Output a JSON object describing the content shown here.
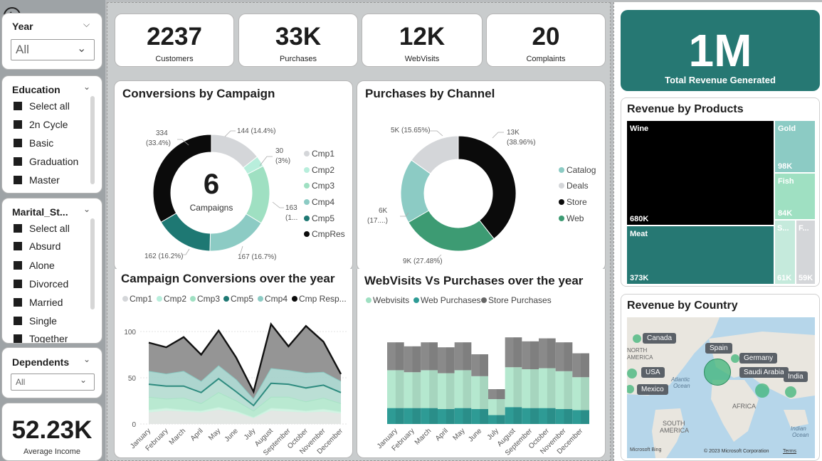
{
  "colors": {
    "teal_dark": "#1e7873",
    "teal": "#2e8b7f",
    "teal_light": "#8ccbc4",
    "mint": "#9fe0c2",
    "grey": "#d4d6d9",
    "black": "#0b0b0b",
    "green": "#3d9b73"
  },
  "back_icon": "back-arrow-icon",
  "slicers": {
    "year": {
      "title": "Year",
      "value": "All"
    },
    "education": {
      "title": "Education",
      "items": [
        "Select all",
        "2n Cycle",
        "Basic",
        "Graduation",
        "Master"
      ]
    },
    "marital": {
      "title": "Marital_St...",
      "items": [
        "Select all",
        "Absurd",
        "Alone",
        "Divorced",
        "Married",
        "Single",
        "Together"
      ]
    },
    "dependents": {
      "title": "Dependents",
      "value": "All"
    }
  },
  "average_income": {
    "value": "52.23K",
    "label": "Average Income"
  },
  "kpis": [
    {
      "value": "2237",
      "label": "Customers"
    },
    {
      "value": "33K",
      "label": "Purchases"
    },
    {
      "value": "12K",
      "label": "WebVisits"
    },
    {
      "value": "20",
      "label": "Complaints"
    }
  ],
  "total_revenue": {
    "value": "1M",
    "label": "Total Revenue Generated"
  },
  "conversions": {
    "title": "Conversions by Campaign",
    "center_value": "6",
    "center_label": "Campaigns",
    "legend": [
      "Cmp1",
      "Cmp2",
      "Cmp3",
      "Cmp4",
      "Cmp5",
      "CmpRes"
    ],
    "data_labels": [
      "144 (14.4%)",
      "30",
      "(3%)",
      "163",
      "(1...",
      "167 (16.7%)",
      "162 (16.2%)",
      "334",
      "(33.4%)"
    ]
  },
  "channels": {
    "title": "Purchases by Channel",
    "legend": [
      "Catalog",
      "Deals",
      "Store",
      "Web"
    ],
    "data_labels": [
      "13K",
      "(38.96%)",
      "9K (27.48%)",
      "6K",
      "(17....)",
      "5K (15.65%)"
    ]
  },
  "campaign_year": {
    "title": "Campaign Conversions over the year",
    "legend": [
      "Cmp1",
      "Cmp2",
      "Cmp3",
      "Cmp5",
      "Cmp4",
      "Cmp Resp..."
    ],
    "y_ticks": [
      "100",
      "50",
      "0"
    ],
    "months": [
      "January",
      "February",
      "March",
      "April",
      "May",
      "June",
      "July",
      "August",
      "September",
      "October",
      "November",
      "December"
    ]
  },
  "web_year": {
    "title": "WebVisits Vs Purchases over the year",
    "legend": [
      "Webvisits",
      "Web Purchases",
      "Store Purchases"
    ],
    "months": [
      "January",
      "February",
      "March",
      "April",
      "May",
      "June",
      "July",
      "August",
      "September",
      "October",
      "November",
      "December"
    ]
  },
  "products": {
    "title": "Revenue by Products",
    "tiles": [
      {
        "name": "Wine",
        "value": "680K"
      },
      {
        "name": "Meat",
        "value": "373K"
      },
      {
        "name": "Gold",
        "value": "98K"
      },
      {
        "name": "Fish",
        "value": "84K"
      },
      {
        "name": "S...",
        "value": "61K"
      },
      {
        "name": "F...",
        "value": "59K"
      }
    ]
  },
  "country": {
    "title": "Revenue by Country",
    "countries": [
      "Canada",
      "Spain",
      "Germany",
      "USA",
      "Saudi Arabia",
      "India",
      "Mexico"
    ],
    "map_labels": [
      "NORTH",
      "AMERICA",
      "Atlantic",
      "Ocean",
      "AFRICA",
      "SOUTH",
      "AMERICA",
      "Indian",
      "Ocean"
    ],
    "attribution": "© 2023 Microsoft Corporation",
    "terms": "Terms",
    "bing": "Microsoft Bing"
  },
  "chart_data": [
    {
      "type": "pie",
      "title": "Conversions by Campaign",
      "categories": [
        "Cmp1",
        "Cmp2",
        "Cmp3",
        "Cmp4",
        "Cmp5",
        "CmpRes"
      ],
      "values": [
        144,
        30,
        163,
        167,
        162,
        334
      ],
      "percentages": [
        14.4,
        3,
        16.3,
        16.7,
        16.2,
        33.4
      ]
    },
    {
      "type": "pie",
      "title": "Purchases by Channel",
      "categories": [
        "Store",
        "Web",
        "Catalog",
        "Deals"
      ],
      "values": [
        13000,
        9000,
        6000,
        5000
      ],
      "percentages": [
        38.96,
        27.48,
        17.91,
        15.65
      ]
    },
    {
      "type": "area",
      "title": "Campaign Conversions over the year",
      "categories": [
        "January",
        "February",
        "March",
        "April",
        "May",
        "June",
        "July",
        "August",
        "September",
        "October",
        "November",
        "December"
      ],
      "ylim": [
        0,
        100
      ],
      "series": [
        {
          "name": "Cmp1",
          "values": [
            12,
            14,
            13,
            12,
            15,
            12,
            6,
            14,
            13,
            12,
            13,
            11
          ]
        },
        {
          "name": "Cmp2",
          "values": [
            3,
            3,
            2,
            2,
            3,
            2,
            1,
            3,
            3,
            2,
            3,
            2
          ]
        },
        {
          "name": "Cmp3",
          "values": [
            14,
            10,
            13,
            8,
            16,
            11,
            7,
            12,
            13,
            10,
            12,
            9
          ]
        },
        {
          "name": "Cmp5",
          "values": [
            14,
            14,
            13,
            12,
            15,
            10,
            6,
            15,
            14,
            15,
            14,
            12
          ]
        },
        {
          "name": "Cmp4",
          "values": [
            14,
            13,
            16,
            12,
            14,
            13,
            7,
            16,
            15,
            16,
            14,
            12
          ]
        },
        {
          "name": "Cmp Resp...",
          "values": [
            31,
            29,
            37,
            29,
            38,
            24,
            8,
            48,
            26,
            51,
            33,
            8
          ]
        }
      ]
    },
    {
      "type": "area",
      "title": "WebVisits Vs Purchases over the year",
      "categories": [
        "January",
        "February",
        "March",
        "April",
        "May",
        "June",
        "July",
        "August",
        "September",
        "October",
        "November",
        "December"
      ],
      "series": [
        {
          "name": "Web Purchases",
          "values": [
            16,
            16,
            16,
            15,
            16,
            15,
            9,
            17,
            16,
            16,
            15,
            14
          ]
        },
        {
          "name": "Webvisits",
          "values": [
            38,
            36,
            38,
            36,
            38,
            33,
            16,
            40,
            39,
            40,
            38,
            33
          ]
        },
        {
          "name": "Store Purchases",
          "values": [
            28,
            26,
            28,
            26,
            28,
            22,
            10,
            30,
            28,
            30,
            29,
            24
          ]
        }
      ]
    },
    {
      "type": "heatmap",
      "title": "Revenue by Products",
      "categories": [
        "Wine",
        "Meat",
        "Gold",
        "Fish",
        "S...",
        "F..."
      ],
      "values": [
        680000,
        373000,
        98000,
        84000,
        61000,
        59000
      ]
    }
  ]
}
